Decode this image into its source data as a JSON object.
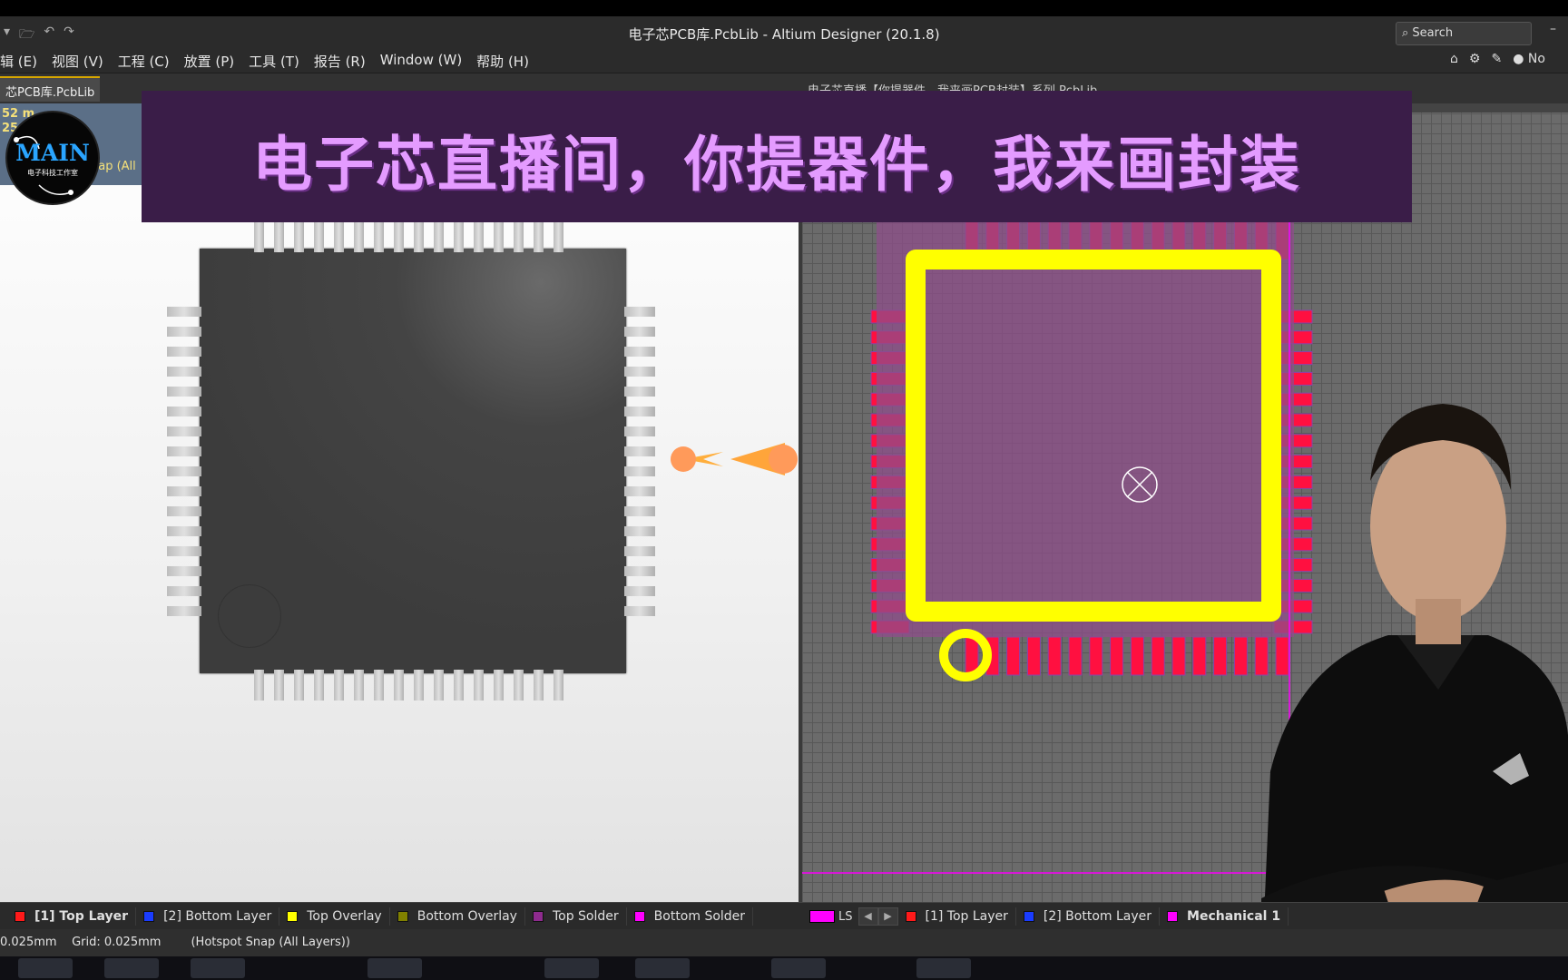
{
  "window": {
    "title": "电子芯PCB库.PcbLib - Altium Designer (20.1.8)",
    "search_placeholder": "Search",
    "minimize": "–"
  },
  "menu": {
    "items": [
      "辑 (E)",
      "视图 (V)",
      "工程 (C)",
      "放置 (P)",
      "工具 (T)",
      "报告 (R)",
      "Window (W)",
      "帮助 (H)"
    ],
    "right_user": "No"
  },
  "doc": {
    "tab_label": "芯PCB库.PcbLib",
    "right_title": "电子芯直播【你提器件，我来画PCB封装】系列.PcbLib"
  },
  "left_info": {
    "line1": "52 m",
    "line2": "25",
    "snap": "nap (All"
  },
  "logo": {
    "main": "MAIN",
    "sub": "电子科技工作室"
  },
  "banner": {
    "text": "电子芯直播间，你提器件，我来画封装"
  },
  "layers_left": [
    {
      "label": "[1] Top Layer",
      "color": "#ff1a1a",
      "active": true
    },
    {
      "label": "[2] Bottom Layer",
      "color": "#1a3cff",
      "active": false
    },
    {
      "label": "Top Overlay",
      "color": "#ffff00",
      "active": false
    },
    {
      "label": "Bottom Overlay",
      "color": "#808000",
      "active": false
    },
    {
      "label": "Top Solder",
      "color": "#8e2b8e",
      "active": false
    },
    {
      "label": "Bottom Solder",
      "color": "#ff00ff",
      "active": false
    }
  ],
  "layers_right": [
    {
      "label": "[1] Top Layer",
      "color": "#ff1a1a",
      "active": false
    },
    {
      "label": "[2] Bottom Layer",
      "color": "#1a3cff",
      "active": false
    },
    {
      "label": "Mechanical 1",
      "color": "#ff00ff",
      "active": true
    }
  ],
  "ls_label": "LS",
  "status": {
    "snap": "0.025mm",
    "grid": "Grid: 0.025mm",
    "hotspot": "(Hotspot Snap (All Layers))"
  },
  "colors": {
    "pad": "#ff1040",
    "overlay": "#ffff00",
    "body_fill": "#8e4e8a",
    "solder_outline": "#ff00ff"
  }
}
